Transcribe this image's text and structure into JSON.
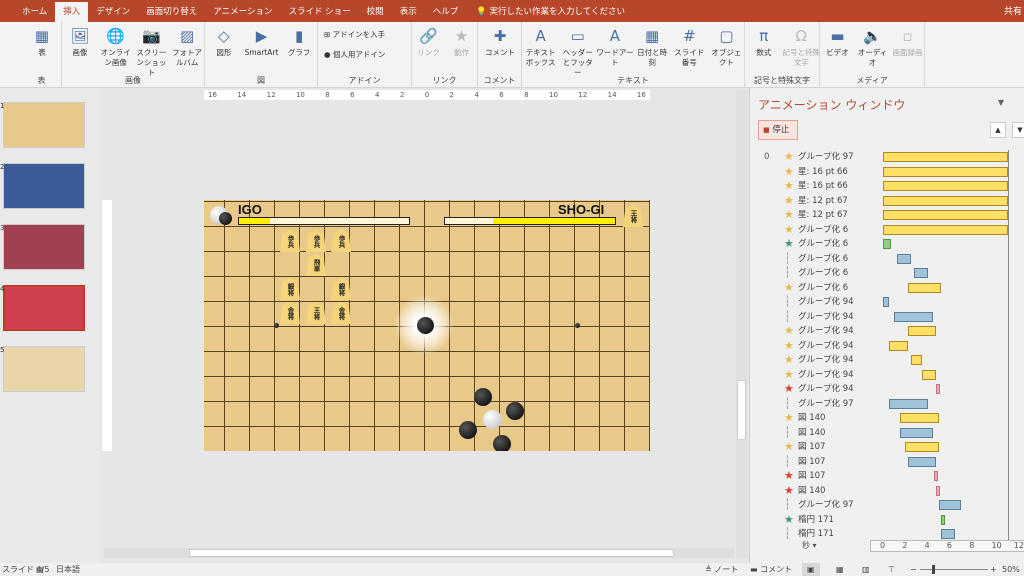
{
  "tabs": [
    "ホーム",
    "挿入",
    "デザイン",
    "画面切り替え",
    "アニメーション",
    "スライド ショー",
    "校閲",
    "表示",
    "ヘルプ"
  ],
  "active_tab": "挿入",
  "tell_me": "実行したい作業を入力してください",
  "share": "共有",
  "ribbon": {
    "groups": [
      {
        "label": "表",
        "buttons": [
          "表"
        ]
      },
      {
        "label": "画像",
        "buttons": [
          "画像",
          "オンライン画像",
          "スクリーンショット",
          "フォトアルバム"
        ]
      },
      {
        "label": "図",
        "buttons": [
          "図形",
          "SmartArt",
          "グラフ"
        ]
      },
      {
        "label": "アドイン",
        "buttons": [
          "アドインを入手",
          "個人用アドイン"
        ]
      },
      {
        "label": "リンク",
        "buttons": [
          "リンク",
          "動作"
        ]
      },
      {
        "label": "コメント",
        "buttons": [
          "コメント"
        ]
      },
      {
        "label": "テキスト",
        "buttons": [
          "テキストボックス",
          "ヘッダーとフッター",
          "ワードアート",
          "日付と時刻",
          "スライド番号",
          "オブジェクト"
        ]
      },
      {
        "label": "記号と特殊文字",
        "buttons": [
          "数式",
          "記号と特殊文字"
        ]
      },
      {
        "label": "メディア",
        "buttons": [
          "ビデオ",
          "オーディオ",
          "画面録画"
        ]
      }
    ]
  },
  "ruler": [
    "16",
    "14",
    "12",
    "10",
    "8",
    "6",
    "4",
    "2",
    "0",
    "2",
    "4",
    "6",
    "8",
    "10",
    "12",
    "14",
    "16"
  ],
  "thumbnails": [
    "1",
    "2",
    "3",
    "4",
    "5"
  ],
  "slide": {
    "igo": "IGO",
    "shogi": "SHO-GI",
    "igo_progress": 0.18,
    "shogi_progress": 0.72,
    "pieces": [
      "歩兵",
      "歩兵",
      "歩兵",
      "飛車",
      "銀将",
      "銀将",
      "金将",
      "王将",
      "金将"
    ],
    "king": "王将"
  },
  "anim_pane": {
    "title": "アニメーション ウィンドウ",
    "stop": "停止",
    "start_num": "0",
    "seconds": "秒",
    "ticks": [
      "0",
      "2",
      "4",
      "6",
      "8",
      "10",
      "12"
    ],
    "colors": {
      "emphasis": "#ffe066",
      "entrance": "#8fd07a",
      "exit": "#f0a8b8",
      "path": "#9fc3d8"
    },
    "items": [
      {
        "name": "グループ化 97",
        "type": "emphasis",
        "start": 0,
        "end": 11.25
      },
      {
        "name": "星: 16 pt 66",
        "type": "emphasis",
        "start": 0,
        "end": 11.25
      },
      {
        "name": "星: 16 pt 66",
        "type": "emphasis",
        "start": 0,
        "end": 11.25
      },
      {
        "name": "星: 12 pt 67",
        "type": "emphasis",
        "start": 0,
        "end": 11.25
      },
      {
        "name": "星: 12 pt 67",
        "type": "emphasis",
        "start": 0,
        "end": 11.25
      },
      {
        "name": "グループ化 6",
        "type": "emphasis",
        "start": 0,
        "end": 11.25
      },
      {
        "name": "グループ化 6",
        "type": "entrance",
        "start": 0,
        "end": 0.75
      },
      {
        "name": "グループ化 6",
        "type": "path",
        "start": 1.25,
        "end": 2.5
      },
      {
        "name": "グループ化 6",
        "type": "path",
        "start": 2.75,
        "end": 4
      },
      {
        "name": "グループ化 6",
        "type": "emphasis",
        "start": 2.25,
        "end": 5.2
      },
      {
        "name": "グループ化 94",
        "type": "path",
        "start": 0,
        "end": 0.5
      },
      {
        "name": "グループ化 94",
        "type": "path",
        "start": 1,
        "end": 4.5
      },
      {
        "name": "グループ化 94",
        "type": "emphasis",
        "start": 2.25,
        "end": 4.75
      },
      {
        "name": "グループ化 94",
        "type": "emphasis",
        "start": 0.5,
        "end": 2.25
      },
      {
        "name": "グループ化 94",
        "type": "emphasis",
        "start": 2.5,
        "end": 3.5
      },
      {
        "name": "グループ化 94",
        "type": "emphasis",
        "start": 3.5,
        "end": 4.75
      },
      {
        "name": "グループ化 94",
        "type": "exit",
        "start": 4.75,
        "end": 5
      },
      {
        "name": "グループ化 97",
        "type": "path",
        "start": 0.5,
        "end": 4
      },
      {
        "name": "図 140",
        "type": "emphasis",
        "start": 1.5,
        "end": 5
      },
      {
        "name": "図 140",
        "type": "path",
        "start": 1.5,
        "end": 4.5
      },
      {
        "name": "図 107",
        "type": "emphasis",
        "start": 2,
        "end": 5
      },
      {
        "name": "図 107",
        "type": "path",
        "start": 2.25,
        "end": 4.75
      },
      {
        "name": "図 107",
        "type": "exit",
        "start": 4.6,
        "end": 4.9
      },
      {
        "name": "図 140",
        "type": "exit",
        "start": 4.75,
        "end": 5
      },
      {
        "name": "グループ化 97",
        "type": "path",
        "start": 5,
        "end": 7
      },
      {
        "name": "楕円 171",
        "type": "entrance",
        "start": 5.2,
        "end": 5.5
      },
      {
        "name": "楕円 171",
        "type": "path",
        "start": 5.2,
        "end": 6.5
      }
    ]
  },
  "status": {
    "slide": "スライド 4/5",
    "language": "日本語",
    "notes": "ノート",
    "comments": "コメント",
    "zoom": "50%"
  }
}
